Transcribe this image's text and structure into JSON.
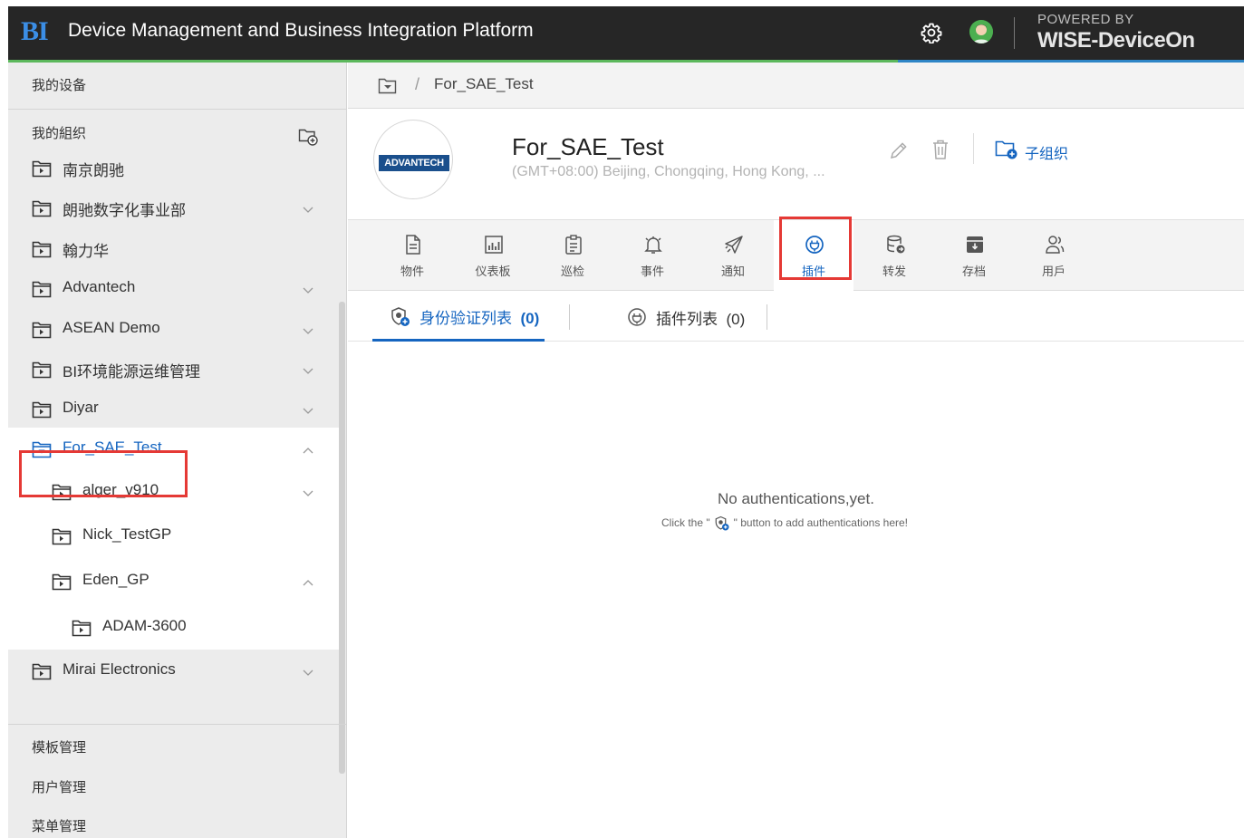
{
  "header": {
    "logo_text": "BI",
    "title": "Device Management and Business Integration Platform",
    "powered_by": "POWERED BY",
    "brand": "WISE-DeviceOn"
  },
  "sidebar": {
    "my_devices": "我的设备",
    "my_org": "我的組织",
    "tree": [
      {
        "label": "南京朗驰",
        "level": 0,
        "chevron": "none",
        "selected": false
      },
      {
        "label": "朗驰数字化事业部",
        "level": 0,
        "chevron": "down",
        "selected": false
      },
      {
        "label": "翰力华",
        "level": 0,
        "chevron": "none",
        "selected": false
      },
      {
        "label": "Advantech",
        "level": 0,
        "chevron": "down",
        "selected": false
      },
      {
        "label": "ASEAN Demo",
        "level": 0,
        "chevron": "down",
        "selected": false
      },
      {
        "label": "BI环境能源运维管理",
        "level": 0,
        "chevron": "down",
        "selected": false
      },
      {
        "label": "Diyar",
        "level": 0,
        "chevron": "down",
        "selected": false
      },
      {
        "label": "For_SAE_Test",
        "level": 0,
        "chevron": "up",
        "selected": true
      },
      {
        "label": "alger_v910",
        "level": 1,
        "chevron": "down",
        "selected": false
      },
      {
        "label": "Nick_TestGP",
        "level": 1,
        "chevron": "none",
        "selected": false
      },
      {
        "label": "Eden_GP",
        "level": 1,
        "chevron": "up",
        "selected": false
      },
      {
        "label": "ADAM-3600",
        "level": 2,
        "chevron": "none",
        "selected": false
      },
      {
        "label": "Mirai Electronics",
        "level": 0,
        "chevron": "down",
        "selected": false
      }
    ],
    "template_mgmt": "模板管理",
    "user_mgmt": "用户管理",
    "menu_mgmt": "菜单管理"
  },
  "breadcrumb": {
    "separator": "/",
    "current": "For_SAE_Test"
  },
  "org": {
    "logo_text": "ADVANTECH",
    "name": "For_SAE_Test",
    "timezone": "(GMT+08:00) Beijing, Chongqing, Hong Kong, ...",
    "sub_org_label": "子组织"
  },
  "tabs": [
    {
      "label": "物件",
      "icon": "document-icon"
    },
    {
      "label": "仪表板",
      "icon": "dashboard-icon"
    },
    {
      "label": "巡检",
      "icon": "clipboard-icon"
    },
    {
      "label": "事件",
      "icon": "bell-icon"
    },
    {
      "label": "通知",
      "icon": "send-icon"
    },
    {
      "label": "插件",
      "icon": "plugin-icon"
    },
    {
      "label": "转发",
      "icon": "forward-icon"
    },
    {
      "label": "存档",
      "icon": "archive-icon"
    },
    {
      "label": "用戶",
      "icon": "users-icon"
    }
  ],
  "active_tab": "插件",
  "subtabs": {
    "auth_list": "身份验证列表",
    "auth_count": "(0)",
    "plugin_list": "插件列表",
    "plugin_count": "(0)"
  },
  "empty": {
    "title": "No authentications,yet.",
    "hint_before": "Click the \"",
    "hint_after": "\" button to add authentications here!"
  },
  "colors": {
    "accent": "#1565c0",
    "header_bg": "#262626",
    "highlight": "#e53935",
    "sidebar_bg": "#ececec"
  }
}
